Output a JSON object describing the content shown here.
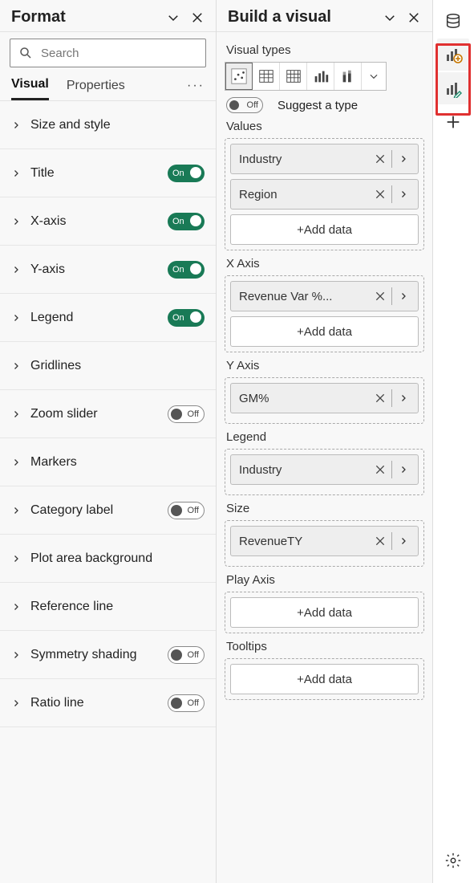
{
  "format": {
    "title": "Format",
    "search_placeholder": "Search",
    "tabs": {
      "visual": "Visual",
      "properties": "Properties"
    },
    "toggle": {
      "on": "On",
      "off": "Off"
    },
    "cards": [
      {
        "label": "Size and style",
        "toggle": null
      },
      {
        "label": "Title",
        "toggle": "on"
      },
      {
        "label": "X-axis",
        "toggle": "on"
      },
      {
        "label": "Y-axis",
        "toggle": "on"
      },
      {
        "label": "Legend",
        "toggle": "on"
      },
      {
        "label": "Gridlines",
        "toggle": null
      },
      {
        "label": "Zoom slider",
        "toggle": "off"
      },
      {
        "label": "Markers",
        "toggle": null
      },
      {
        "label": "Category label",
        "toggle": "off"
      },
      {
        "label": "Plot area background",
        "toggle": null
      },
      {
        "label": "Reference line",
        "toggle": null
      },
      {
        "label": "Symmetry shading",
        "toggle": "off"
      },
      {
        "label": "Ratio line",
        "toggle": "off"
      }
    ]
  },
  "build": {
    "title": "Build a visual",
    "visual_types_label": "Visual types",
    "suggest_off": "Off",
    "suggest_label": "Suggest a type",
    "add_data": "+Add data",
    "visual_type_icons": [
      "scatter",
      "table",
      "matrix",
      "bar-clustered",
      "bar-stacked"
    ],
    "wells": [
      {
        "label": "Values",
        "fields": [
          "Industry",
          "Region"
        ],
        "add": true
      },
      {
        "label": "X Axis",
        "fields": [
          "Revenue Var %..."
        ],
        "add": true
      },
      {
        "label": "Y Axis",
        "fields": [
          "GM%"
        ],
        "add": false
      },
      {
        "label": "Legend",
        "fields": [
          "Industry"
        ],
        "add": false
      },
      {
        "label": "Size",
        "fields": [
          "RevenueTY"
        ],
        "add": false
      },
      {
        "label": "Play Axis",
        "fields": [],
        "add": true
      },
      {
        "label": "Tooltips",
        "fields": [],
        "add": true
      }
    ]
  }
}
